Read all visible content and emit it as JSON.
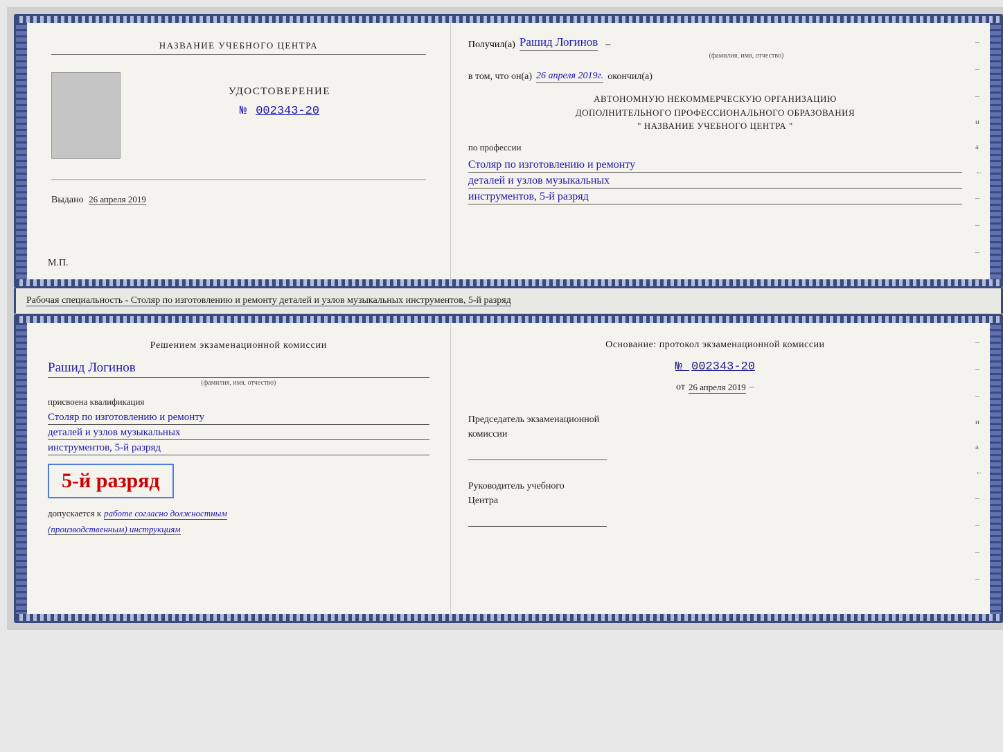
{
  "page": {
    "background": "#d8d8d8"
  },
  "top_doc": {
    "left": {
      "org_name": "НАЗВАНИЕ УЧЕБНОГО ЦЕНТРА",
      "cert_title": "УДОСТОВЕРЕНИЕ",
      "cert_number_prefix": "№",
      "cert_number": "002343-20",
      "issued_label": "Выдано",
      "issued_date": "26 апреля 2019",
      "mp": "М.П."
    },
    "right": {
      "received_label": "Получил(а)",
      "recipient_name": "Рашид Логинов",
      "recipient_subtitle": "(фамилия, имя, отчество)",
      "date_prefix": "в том, что он(а)",
      "completion_date": "26 апреля 2019г.",
      "date_suffix": "окончил(а)",
      "org_line1": "АВТОНОМНУЮ НЕКОММЕРЧЕСКУЮ ОРГАНИЗАЦИЮ",
      "org_line2": "ДОПОЛНИТЕЛЬНОГО ПРОФЕССИОНАЛЬНОГО ОБРАЗОВАНИЯ",
      "org_line3": "\"  НАЗВАНИЕ УЧЕБНОГО ЦЕНТРА  \"",
      "profession_prefix": "по профессии",
      "profession_line1": "Столяр по изготовлению и ремонту",
      "profession_line2": "деталей и узлов музыкальных",
      "profession_line3": "инструментов, 5-й разряд",
      "dash1": "–",
      "dash2": "–",
      "dash3": "–",
      "dash4": "и",
      "dash5": "а",
      "dash6": "←",
      "dash7": "–",
      "dash8": "–",
      "dash9": "–",
      "dash10": "–"
    }
  },
  "specialty_line": {
    "text": "Рабочая специальность - Столяр по изготовлению и ремонту деталей и узлов музыкальных инструментов, 5-й разряд"
  },
  "bottom_doc": {
    "left": {
      "decision_text": "Решением экзаменационной комиссии",
      "name": "Рашид Логинов",
      "name_subtitle": "(фамилия, имя, отчество)",
      "qualification_prefix": "присвоена квалификация",
      "qualification_line1": "Столяр по изготовлению и ремонту",
      "qualification_line2": "деталей и узлов музыкальных",
      "qualification_line3": "инструментов, 5-й разряд",
      "rank_label": "5-й разряд",
      "allowed_prefix": "допускается к",
      "allowed_text": "работе согласно должностным",
      "allowed_text2": "(производственным) инструкциям"
    },
    "right": {
      "basis_text": "Основание: протокол экзаменационной  комиссии",
      "protocol_prefix": "№",
      "protocol_number": "002343-20",
      "date_prefix": "от",
      "date_value": "26 апреля 2019",
      "chairman_label": "Председатель экзаменационной",
      "chairman_label2": "комиссии",
      "director_label": "Руководитель учебного",
      "director_label2": "Центра",
      "dash1": "–",
      "dash2": "–",
      "dash3": "–",
      "dash4": "и",
      "dash5": "а",
      "dash6": "←",
      "dash7": "–",
      "dash8": "–",
      "dash9": "–",
      "dash10": "–"
    }
  }
}
